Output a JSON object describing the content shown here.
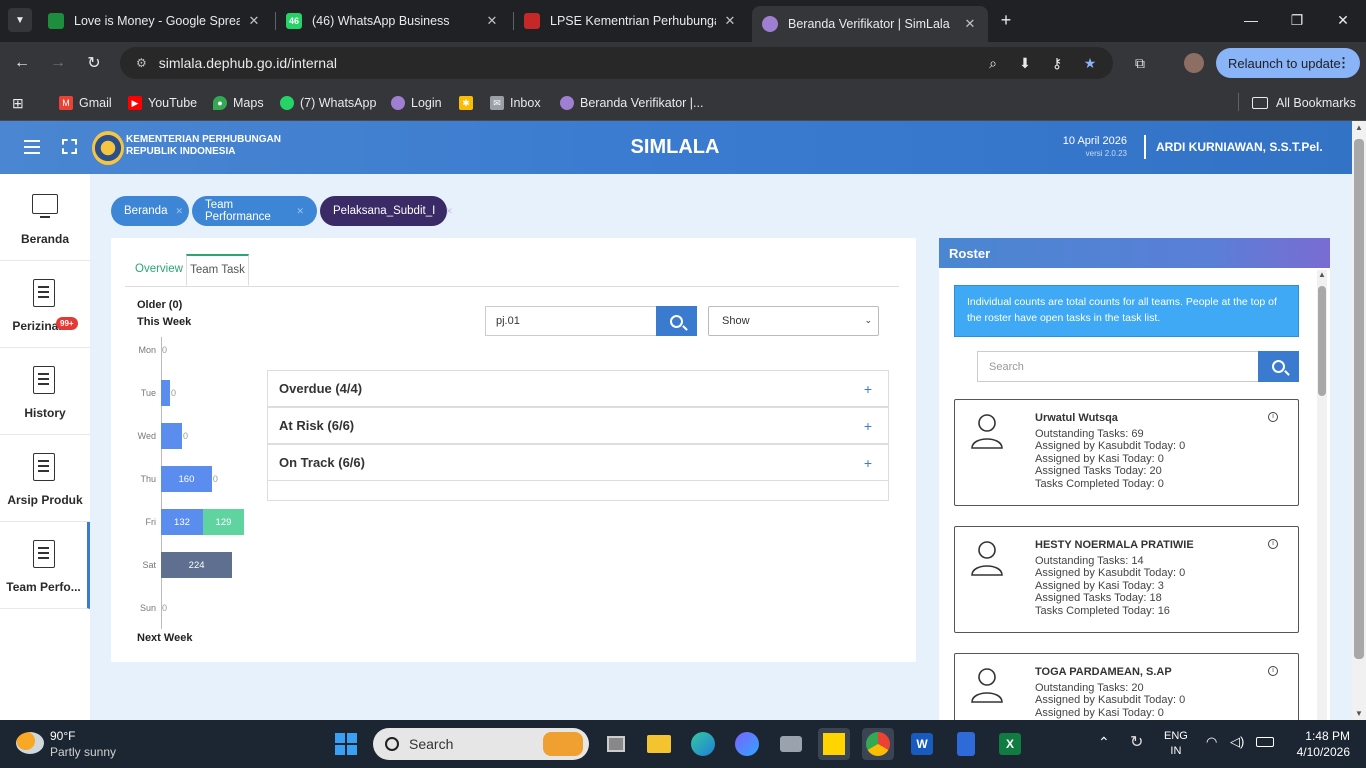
{
  "browser": {
    "tabs": [
      {
        "title": "Love is Money - Google Spread",
        "favicon_color": "#1e8e3e",
        "favicon_text": ""
      },
      {
        "title": "(46) WhatsApp Business",
        "favicon_color": "#25d366",
        "favicon_text": "46"
      },
      {
        "title": "LPSE Kementrian Perhubungan",
        "favicon_color": "#c62828",
        "favicon_text": ""
      },
      {
        "title": "Beranda Verifikator | SimLala",
        "favicon_color": "#9e7fd1",
        "favicon_text": ""
      }
    ],
    "url": "simlala.dephub.go.id/internal",
    "relaunch_label": "Relaunch to update",
    "bookmarks": [
      {
        "label": "Gmail",
        "color": "#ea4335"
      },
      {
        "label": "YouTube",
        "color": "#ff0000"
      },
      {
        "label": "Maps",
        "color": "#34a853"
      },
      {
        "label": "(7) WhatsApp",
        "color": "#25d366"
      },
      {
        "label": "Login",
        "color": "#9e7fd1"
      },
      {
        "label": "",
        "color": "#fbbc04"
      },
      {
        "label": "Inbox",
        "color": "#9aa0a6"
      },
      {
        "label": "Beranda Verifikator |...",
        "color": "#9e7fd1"
      }
    ],
    "all_bookmarks_label": "All Bookmarks"
  },
  "app": {
    "ministry_line1": "KEMENTERIAN PERHUBUNGAN",
    "ministry_line2": "REPUBLIK INDONESIA",
    "title": "SIMLALA",
    "date": "10 April 2026",
    "version": "versi 2.0.23",
    "user": "ARDI KURNIAWAN, S.S.T.Pel."
  },
  "sidebar": {
    "items": [
      {
        "label": "Beranda",
        "badge": ""
      },
      {
        "label": "Perizinan",
        "badge": "99+"
      },
      {
        "label": "History",
        "badge": ""
      },
      {
        "label": "Arsip Produk",
        "badge": ""
      },
      {
        "label": "Team Perfo...",
        "badge": ""
      }
    ]
  },
  "breadcrumbs": [
    {
      "label": "Beranda"
    },
    {
      "label": "Team Performance"
    },
    {
      "label": "Pelaksana_Subdit_I"
    }
  ],
  "main": {
    "tabs": [
      {
        "label": "Overview"
      },
      {
        "label": "Team Task"
      }
    ],
    "older_label": "Older (0)",
    "this_week_label": "This Week",
    "next_week_label": "Next Week",
    "search_value": "pj.01",
    "show_select": "Show",
    "accordion": [
      {
        "label": "Overdue (4/4)"
      },
      {
        "label": "At Risk (6/6)"
      },
      {
        "label": "On Track (6/6)"
      }
    ]
  },
  "chart_data": {
    "type": "bar",
    "orientation": "horizontal",
    "stacked": true,
    "categories": [
      "Mon",
      "Tue",
      "Wed",
      "Thu",
      "Fri",
      "Sat",
      "Sun"
    ],
    "series": [
      {
        "values": [
          0,
          0,
          0,
          160,
          132,
          224,
          0
        ],
        "color": "#5b8def"
      },
      {
        "values": [
          0,
          0,
          0,
          0,
          129,
          0,
          0
        ],
        "color": "#5fd3a0"
      },
      {
        "values": [
          0,
          0,
          0,
          0,
          0,
          0,
          0
        ],
        "color": "#5f6f8f"
      }
    ],
    "data_labels": [
      "0",
      "0",
      "0",
      "160",
      "132",
      "129",
      "224",
      "0"
    ]
  },
  "roster": {
    "title": "Roster",
    "info": "Individual counts are total counts for all teams. People at the top of the roster have open tasks in the task list.",
    "search_placeholder": "Search",
    "people": [
      {
        "name": "Urwatul Wutsqa",
        "lines": [
          "Outstanding Tasks: 69",
          "Assigned by Kasubdit Today: 0",
          "Assigned by Kasi Today: 0",
          "Assigned Tasks Today: 20",
          "Tasks Completed Today: 0"
        ]
      },
      {
        "name": "HESTY NOERMALA PRATIWIE",
        "lines": [
          "Outstanding Tasks: 14",
          "Assigned by Kasubdit Today: 0",
          "Assigned by Kasi Today: 3",
          "Assigned Tasks Today: 18",
          "Tasks Completed Today: 16"
        ]
      },
      {
        "name": "TOGA PARDAMEAN, S.AP",
        "lines": [
          "Outstanding Tasks: 20",
          "Assigned by Kasubdit Today: 0",
          "Assigned by Kasi Today: 0"
        ]
      }
    ]
  },
  "taskbar": {
    "weather_temp": "90°F",
    "weather_desc": "Partly sunny",
    "search_placeholder": "Search",
    "lang_line1": "ENG",
    "lang_line2": "IN",
    "time": "1:48 PM",
    "date": "4/10/2026"
  }
}
